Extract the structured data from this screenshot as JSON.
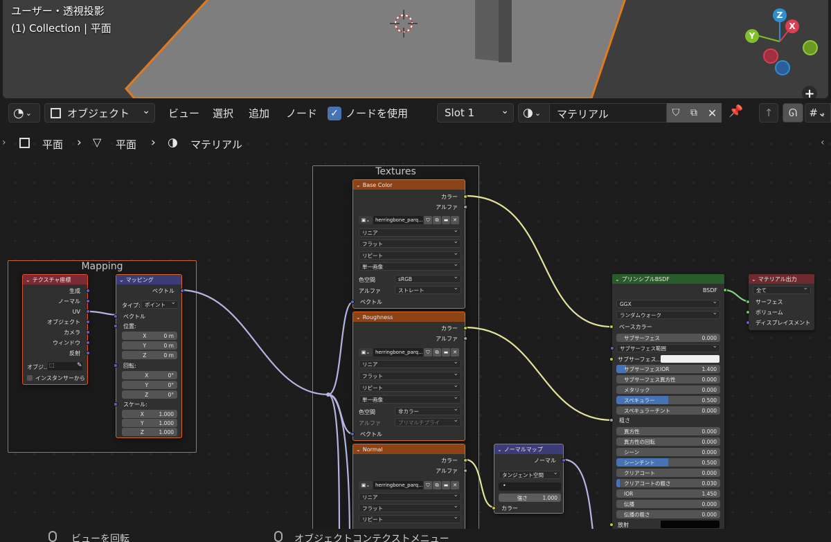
{
  "viewport": {
    "view_name": "ユーザー・透視投影",
    "collection_label": "(1) Collection | 平面",
    "gizmo": {
      "z": "Z",
      "y": "Y",
      "x": "X"
    }
  },
  "header": {
    "editor_icon": "node-editor-icon",
    "mode_label": "オブジェクト",
    "menus": [
      "ビュー",
      "選択",
      "追加",
      "ノード"
    ],
    "use_nodes_label": "ノードを使用",
    "slot_label": "Slot 1",
    "material_name": "マテリアル"
  },
  "breadcrumb": {
    "object": "平面",
    "mesh": "平面",
    "material": "マテリアル"
  },
  "frames": {
    "mapping_title": "Mapping",
    "textures_title": "Textures"
  },
  "nodes": {
    "texcoord": {
      "title": "テクスチャ座標",
      "outputs": [
        "生成",
        "ノーマル",
        "UV",
        "オブジェクト",
        "カメラ",
        "ウィンドウ",
        "反射"
      ],
      "object_label": "オブジ...",
      "instancer_label": "インスタンサーから"
    },
    "mapping": {
      "title": "マッピング",
      "output": "ベクトル",
      "type_label": "タイプ:",
      "type_value": "ポイント",
      "vector_label": "ベクトル",
      "location_label": "位置:",
      "location": [
        {
          "axis": "X",
          "value": "0 m"
        },
        {
          "axis": "Y",
          "value": "0 m"
        },
        {
          "axis": "Z",
          "value": "0 m"
        }
      ],
      "rotation_label": "回転:",
      "rotation": [
        {
          "axis": "X",
          "value": "0°"
        },
        {
          "axis": "Y",
          "value": "0°"
        },
        {
          "axis": "Z",
          "value": "0°"
        }
      ],
      "scale_label": "スケール:",
      "scale": [
        {
          "axis": "X",
          "value": "1.000"
        },
        {
          "axis": "Y",
          "value": "1.000"
        },
        {
          "axis": "Z",
          "value": "1.000"
        }
      ]
    },
    "base_color": {
      "title": "Base Color",
      "out_color": "カラー",
      "out_alpha": "アルファ",
      "image": "herringbone_parq...",
      "interpolation": "リニア",
      "projection": "フラット",
      "extension": "リピート",
      "source": "単一画像",
      "colorspace_label": "色空間",
      "colorspace": "sRGB",
      "alpha_label": "アルファ",
      "alpha": "ストレート",
      "vector_label": "ベクトル"
    },
    "roughness": {
      "title": "Roughness",
      "out_color": "カラー",
      "out_alpha": "アルファ",
      "image": "herringbone_parq...",
      "interpolation": "リニア",
      "projection": "フラット",
      "extension": "リピート",
      "source": "単一画像",
      "colorspace_label": "色空間",
      "colorspace": "非カラー",
      "alpha_label": "アルファ",
      "alpha": "プリマルチプライ",
      "vector_label": "ベクトル"
    },
    "normal": {
      "title": "Normal",
      "out_color": "カラー",
      "out_alpha": "アルファ",
      "image": "herringbone_parq...",
      "interpolation": "リニア",
      "projection": "フラット",
      "extension": "リピート"
    },
    "normal_map": {
      "title": "ノーマルマップ",
      "output": "ノーマル",
      "space": "タンジェント空間",
      "uv_value": "•",
      "strength_label": "強さ",
      "strength": "1.000",
      "strength_fraction": 1.0,
      "color_label": "カラー"
    },
    "bsdf": {
      "title": "プリンシプルBSDF",
      "output": "BSDF",
      "distribution": "GGX",
      "subsurface_method": "ランダムウォーク",
      "base_color_label": "ベースカラー",
      "subsurface_range_label": "サブサーフェス範囲",
      "subsurface_color_label": "サブサーフェス...",
      "roughness_label": "粗さ",
      "emission_label": "放射",
      "fields": [
        {
          "label": "サブサーフェス",
          "value": "0.000",
          "fill": 0
        },
        {
          "label": "サブサーフェスIOR",
          "value": "1.400",
          "fill": 0.093
        },
        {
          "label": "サブサーフェス異方性",
          "value": "0.000",
          "fill": 0
        },
        {
          "label": "メタリック",
          "value": "0.000",
          "fill": 0
        },
        {
          "label": "スペキュラー",
          "value": "0.500",
          "fill": 0.5
        },
        {
          "label": "スペキュラーチント",
          "value": "0.000",
          "fill": 0
        },
        {
          "label": "異方性",
          "value": "0.000",
          "fill": 0
        },
        {
          "label": "異方性の回転",
          "value": "0.000",
          "fill": 0
        },
        {
          "label": "シーン",
          "value": "0.000",
          "fill": 0
        },
        {
          "label": "シーンチント",
          "value": "0.500",
          "fill": 0.5
        },
        {
          "label": "クリアコート",
          "value": "0.000",
          "fill": 0
        },
        {
          "label": "クリアコートの粗さ",
          "value": "0.030",
          "fill": 0.03
        },
        {
          "label": "IOR",
          "value": "1.450",
          "fill": 0
        },
        {
          "label": "伝播",
          "value": "0.000",
          "fill": 0
        },
        {
          "label": "伝播の粗さ",
          "value": "0.000",
          "fill": 0
        }
      ]
    },
    "output": {
      "title": "マテリアル出力",
      "target": "全て",
      "inputs": [
        "サーフェス",
        "ボリューム",
        "ディスプレイスメント"
      ]
    }
  },
  "footer": {
    "left_hint": "ビューを回転",
    "right_hint": "オブジェクトコンテクストメニュー"
  }
}
